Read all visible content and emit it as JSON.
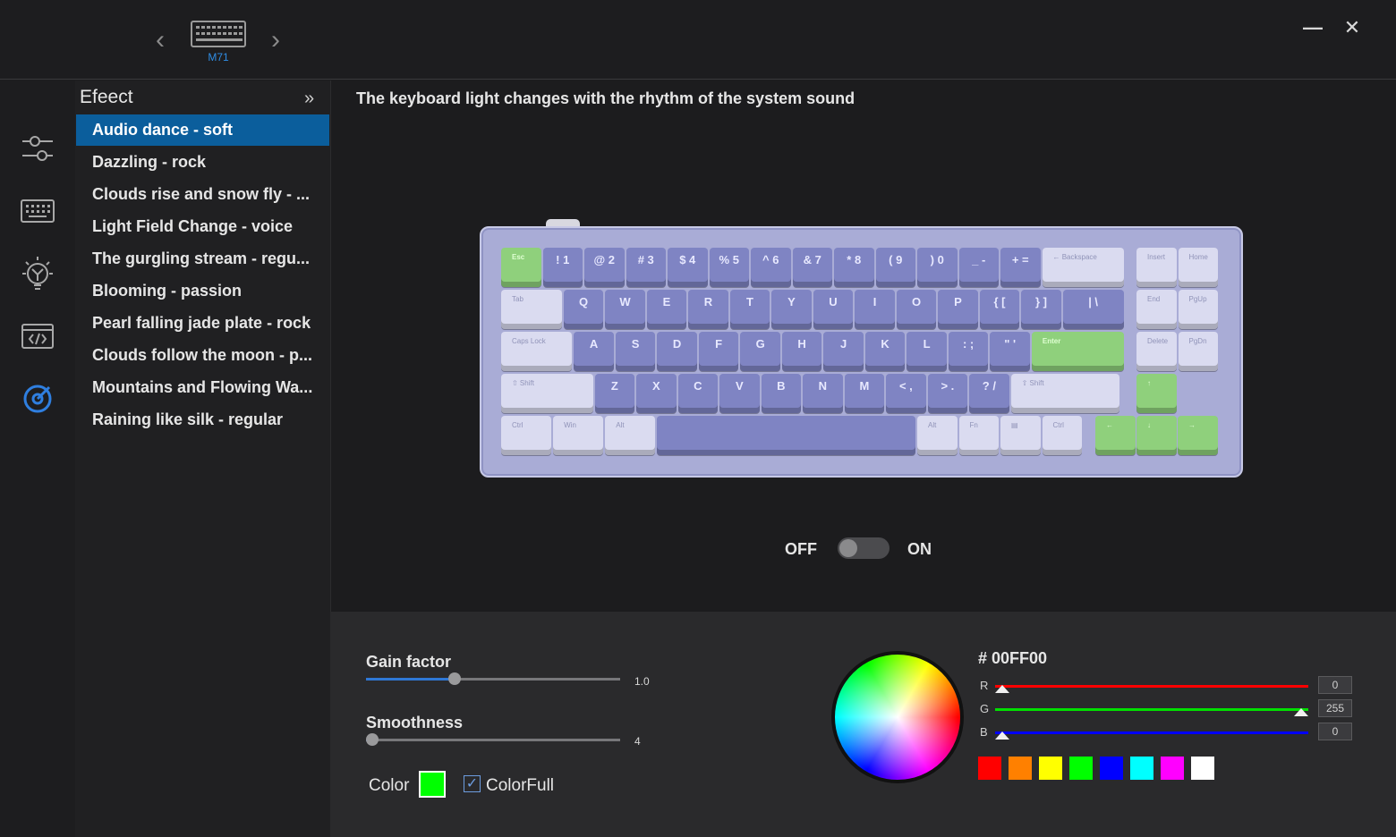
{
  "header": {
    "device_name": "M71",
    "prev_glyph": "‹",
    "next_glyph": "›",
    "minimize_glyph": "—",
    "close_glyph": "✕"
  },
  "rail": {
    "items": [
      {
        "icon": "sliders-icon",
        "active": false
      },
      {
        "icon": "keyboard-icon",
        "active": false
      },
      {
        "icon": "lightbulb-icon",
        "active": false
      },
      {
        "icon": "code-window-icon",
        "active": false
      },
      {
        "icon": "target-icon",
        "active": true
      }
    ]
  },
  "effects": {
    "title": "Efeect",
    "collapse_glyph": "»",
    "items": [
      "Audio dance - soft",
      "Dazzling - rock",
      "Clouds rise and snow fly - ...",
      "Light Field Change - voice",
      "The gurgling stream - regu...",
      "Blooming - passion",
      "Pearl falling jade plate - rock",
      "Clouds follow the moon - p...",
      "Mountains and Flowing Wa...",
      "Raining like silk - regular"
    ],
    "selected_index": 0
  },
  "main": {
    "description": "The keyboard light changes with the rhythm of the system sound",
    "toggle": {
      "off_label": "OFF",
      "on_label": "ON",
      "state": "off"
    }
  },
  "keyboard": {
    "row1": [
      "Esc",
      "!\n1",
      "@\n2",
      "#\n3",
      "$\n4",
      "%\n5",
      "^\n6",
      "&\n7",
      "*\n8",
      "(\n9",
      ")\n0",
      "_\n-",
      "+\n=",
      "← Backspace",
      "Insert",
      "Home"
    ],
    "row2": [
      "Tab",
      "Q",
      "W",
      "E",
      "R",
      "T",
      "Y",
      "U",
      "I",
      "O",
      "P",
      "{\n[",
      "}\n]",
      "|\n\\",
      "End",
      "PgUp"
    ],
    "row3": [
      "Caps Lock",
      "A",
      "S",
      "D",
      "F",
      "G",
      "H",
      "J",
      "K",
      "L",
      ":\n;",
      "\"\n'",
      "Enter",
      "Delete",
      "PgDn"
    ],
    "row4": [
      "⇧ Shift",
      "Z",
      "X",
      "C",
      "V",
      "B",
      "N",
      "M",
      "<\n,",
      ">\n.",
      "?\n/",
      "⇧ Shift",
      "↑"
    ],
    "row5": [
      "Ctrl",
      "Win",
      "Alt",
      "",
      "Alt",
      "Fn",
      "▤",
      "Ctrl",
      "←",
      "↓",
      "→"
    ]
  },
  "controls": {
    "gain": {
      "label": "Gain factor",
      "value": "1.0",
      "fraction": 0.34
    },
    "smoothness": {
      "label": "Smoothness",
      "value": "4",
      "fraction": 0.0
    },
    "color_label": "Color",
    "colorful_label": "ColorFull",
    "colorful_checked": true,
    "colorful_check_glyph": "✓",
    "current_color": "#00FF00"
  },
  "picker": {
    "hex_label": "# 00FF00",
    "channels": [
      {
        "label": "R",
        "value": "0",
        "fraction": 0.0,
        "color": "#ff0000"
      },
      {
        "label": "G",
        "value": "255",
        "fraction": 1.0,
        "color": "#00e000"
      },
      {
        "label": "B",
        "value": "0",
        "fraction": 0.0,
        "color": "#0000ff"
      }
    ],
    "presets": [
      "#ff0000",
      "#ff8000",
      "#ffff00",
      "#00ff00",
      "#0000ff",
      "#00ffff",
      "#ff00ff",
      "#ffffff"
    ]
  }
}
